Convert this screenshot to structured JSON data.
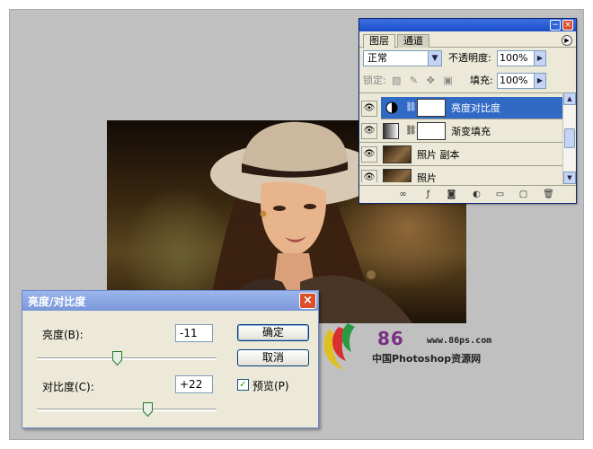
{
  "layers_panel": {
    "tabs": [
      "图层",
      "通道"
    ],
    "blend_mode": "正常",
    "opacity_label": "不透明度:",
    "opacity_value": "100%",
    "lock_label": "锁定:",
    "fill_label": "填充:",
    "fill_value": "100%",
    "layers": [
      {
        "name": "亮度对比度",
        "selected": true,
        "thumb": "adjustment"
      },
      {
        "name": "渐变填充",
        "selected": false,
        "thumb": "gradient"
      },
      {
        "name": "照片 副本",
        "selected": false,
        "thumb": "photo"
      },
      {
        "name": "照片",
        "selected": false,
        "thumb": "photo"
      }
    ]
  },
  "dialog": {
    "title": "亮度/对比度",
    "brightness_label": "亮度(B):",
    "brightness_value": "-11",
    "contrast_label": "对比度(C):",
    "contrast_value": "+22",
    "ok_label": "确定",
    "cancel_label": "取消",
    "preview_label": "预览(P)",
    "preview_checked": true
  },
  "watermark": {
    "number": "86",
    "url": "www.86ps.com",
    "text": "中国Photoshop资源网"
  }
}
